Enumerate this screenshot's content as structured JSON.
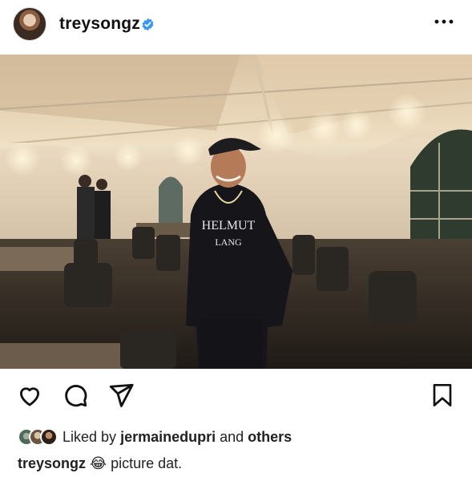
{
  "post": {
    "username": "treysongz",
    "likes": {
      "prefix": "Liked by",
      "user": "jermainedupri",
      "joiner": "and",
      "others": "others"
    },
    "caption": {
      "username": "treysongz",
      "emoji": "😂",
      "text": "picture dat."
    }
  },
  "icons": {
    "verified": "verified-badge-icon",
    "more": "more-options-icon",
    "like": "heart-icon",
    "comment": "comment-icon",
    "share": "send-icon",
    "save": "bookmark-icon"
  },
  "colors": {
    "verified_blue": "#3897f0",
    "text": "#111111"
  }
}
